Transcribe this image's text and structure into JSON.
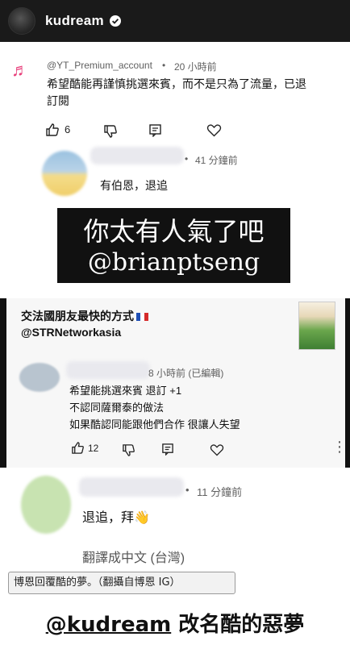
{
  "story": {
    "username": "kudream"
  },
  "comment1": {
    "author": "@YT_Premium_account",
    "time": "20 小時前",
    "text_line1": "希望酷能再謹慎挑選來賓，而不是只為了流量，已退",
    "text_line2": "訂閱",
    "likes": "6"
  },
  "reply1": {
    "time": "41 分鐘前",
    "text": "有伯恩，退追"
  },
  "overlay": {
    "line1": "你太有人氣了吧",
    "line2": "@brianptseng"
  },
  "promo": {
    "title": "交法國朋友最快的方式",
    "handle": "@STRNetworkasia"
  },
  "comment2": {
    "time": "8 小時前 (已編輯)",
    "line1": "希望能挑選來賓 退訂 +1",
    "line2": "不認同薩爾泰的做法",
    "line3": "如果酷認同能跟他們合作 很讓人失望",
    "likes": "12"
  },
  "comment3": {
    "time": "11 分鐘前",
    "text": "退追，拜👋",
    "translate": "翻譯成中文 (台灣)"
  },
  "caption": {
    "text": "博恩回覆酷的夢。（翻攝自博恩 IG）"
  },
  "headline": {
    "handle": "@kudream",
    "rest": " 改名酷的惡夢"
  },
  "colors": {
    "accent_pink": "#e8407b",
    "header_bg": "#1a1a1a"
  }
}
